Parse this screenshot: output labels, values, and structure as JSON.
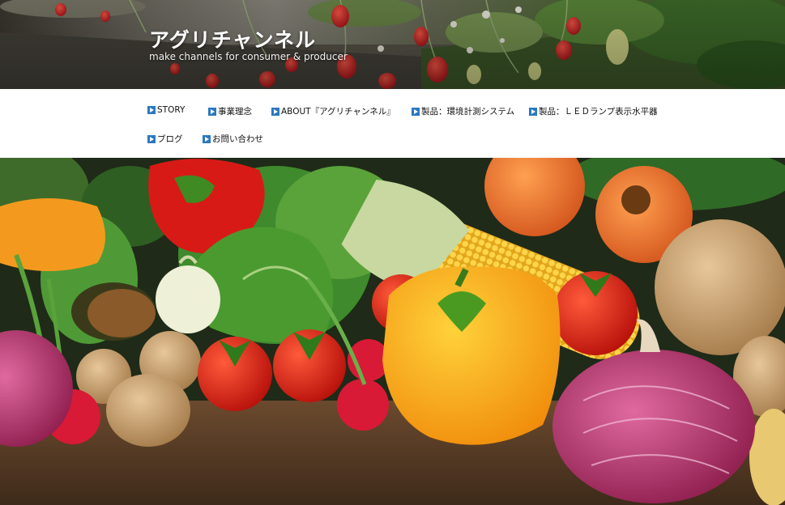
{
  "site": {
    "title": "アグリチャンネル",
    "tagline": "make channels for consumer & producer"
  },
  "nav": {
    "items": [
      {
        "label": "STORY",
        "icon": "play-square-icon"
      },
      {
        "label": "事業理念",
        "icon": "play-square-icon"
      },
      {
        "label": "ABOUT『アグリチャンネル』",
        "icon": "play-square-icon"
      },
      {
        "label": "製品：環境計測システム",
        "icon": "play-square-icon"
      },
      {
        "label": "製品：ＬＥＤランプ表示水平器",
        "icon": "play-square-icon"
      },
      {
        "label": "ブログ",
        "icon": "play-square-icon"
      },
      {
        "label": "お問い合わせ",
        "icon": "play-square-icon"
      }
    ]
  },
  "colors": {
    "nav_icon": "#2a78c2",
    "nav_text": "#111111",
    "title_text": "#ffffff"
  },
  "images": {
    "header_banner": "strawberry-greenhouse-photo",
    "hero": "fresh-vegetables-photo"
  }
}
